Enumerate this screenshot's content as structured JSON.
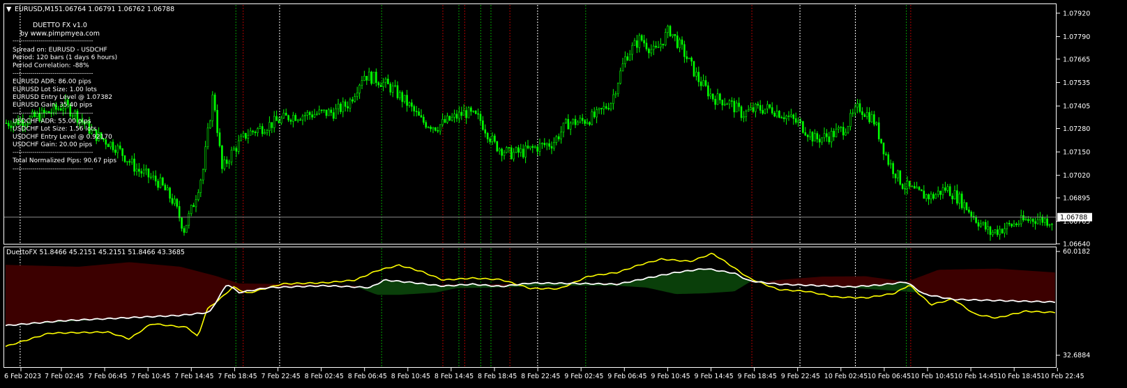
{
  "main_header": {
    "arrow": "▼",
    "symbol": "EURUSD,M15",
    "ohlc": "1.06764 1.06791 1.06762 1.06788"
  },
  "info_panel": {
    "title": "DUETTO FX v1.0",
    "byline": "by www.pimpmyea.com",
    "lines_1": [
      "Spread on: EURUSD - USDCHF",
      "Period: 120 bars (1 days 6 hours)",
      "Period Correlation: -88%"
    ],
    "lines_2": [
      "EURUSD ADR: 86.00   pips",
      "EURUSD Lot Size: 1.00 lots",
      "EURUSD Entry Level @ 1.07382",
      "EURUSD Gain: 35.40 pips"
    ],
    "lines_3": [
      "USDCHF ADR: 55.00   pips",
      "USDCHF Lot Size: 1.56 lots",
      "USDCHF Entry Level @ 0.92170",
      "USDCHF Gain: 20.00 pips"
    ],
    "lines_4": [
      "Total Normalized Pips: 90.67 pips"
    ],
    "separator": "----------------------------------------"
  },
  "indicator_header": {
    "text": "DuettoFX 51.8466 45.2151 45.2151 51.8466 43.3685"
  },
  "colors": {
    "background": "#000000",
    "candle": "#00ff00",
    "grid_border": "#ffffff",
    "axis_text": "#ffffff",
    "band_red": "#3c0000",
    "band_green": "#0a3f0a",
    "white_line": "#ffffff",
    "yellow_line": "#ffff00",
    "vline_white": "#ffffff",
    "vline_green": "#00a000",
    "vline_red": "#b00000"
  },
  "chart_data": [
    {
      "type": "candlestick",
      "title": "EURUSD,M15",
      "y_ticks": [
        "1.07920",
        "1.07790",
        "1.07665",
        "1.07535",
        "1.07405",
        "1.07280",
        "1.07150",
        "1.07020",
        "1.06895",
        "1.06765",
        "1.06640"
      ],
      "ylim": [
        1.0664,
        1.0797
      ],
      "current_price_label": "1.06788",
      "current_price": 1.06788,
      "x_labels": [
        "6 Feb 2023",
        "7 Feb 02:45",
        "7 Feb 06:45",
        "7 Feb 10:45",
        "7 Feb 14:45",
        "7 Feb 18:45",
        "7 Feb 22:45",
        "8 Feb 02:45",
        "8 Feb 06:45",
        "8 Feb 10:45",
        "8 Feb 14:45",
        "8 Feb 18:45",
        "8 Feb 22:45",
        "9 Feb 02:45",
        "9 Feb 06:45",
        "9 Feb 10:45",
        "9 Feb 14:45",
        "9 Feb 18:45",
        "9 Feb 22:45",
        "10 Feb 02:45",
        "10 Feb 06:45",
        "10 Feb 10:45",
        "10 Feb 14:45",
        "10 Feb 18:45",
        "10 Feb 22:45"
      ],
      "close_path": [
        [
          0,
          1.0731
        ],
        [
          1.5,
          1.0733
        ],
        [
          3,
          1.0737
        ],
        [
          4,
          1.0741
        ],
        [
          5,
          1.0734
        ],
        [
          6,
          1.0725
        ],
        [
          7.5,
          1.0718
        ],
        [
          9,
          1.0705
        ],
        [
          10.5,
          1.0698
        ],
        [
          11.5,
          1.0687
        ],
        [
          12.2,
          1.0672
        ],
        [
          12.8,
          1.0685
        ],
        [
          13.5,
          1.0705
        ],
        [
          14.2,
          1.0748
        ],
        [
          14.8,
          1.0705
        ],
        [
          15.5,
          1.0715
        ],
        [
          16.5,
          1.0725
        ],
        [
          18,
          1.073
        ],
        [
          19.5,
          1.0735
        ],
        [
          21,
          1.0736
        ],
        [
          22.5,
          1.0737
        ],
        [
          23.5,
          1.0742
        ],
        [
          24.5,
          1.0758
        ],
        [
          25.5,
          1.0755
        ],
        [
          26.5,
          1.075
        ],
        [
          27.5,
          1.0742
        ],
        [
          28.5,
          1.0732
        ],
        [
          29.5,
          1.0729
        ],
        [
          30.5,
          1.0733
        ],
        [
          31.5,
          1.0737
        ],
        [
          32.5,
          1.0733
        ],
        [
          33.5,
          1.0719
        ],
        [
          34.5,
          1.0714
        ],
        [
          35.5,
          1.0715
        ],
        [
          36.5,
          1.0718
        ],
        [
          37.5,
          1.072
        ],
        [
          38.5,
          1.0731
        ],
        [
          39.5,
          1.0732
        ],
        [
          40.5,
          1.0735
        ],
        [
          41.5,
          1.0743
        ],
        [
          42.5,
          1.0768
        ],
        [
          43.5,
          1.0778
        ],
        [
          44.5,
          1.077
        ],
        [
          45.5,
          1.0783
        ],
        [
          46.5,
          1.077
        ],
        [
          47.5,
          1.0755
        ],
        [
          48.5,
          1.0745
        ],
        [
          49.5,
          1.0743
        ],
        [
          50.5,
          1.0736
        ],
        [
          51.5,
          1.0739
        ],
        [
          52.5,
          1.0739
        ],
        [
          53.5,
          1.0735
        ],
        [
          54.5,
          1.073
        ],
        [
          55.5,
          1.0722
        ],
        [
          56.5,
          1.0724
        ],
        [
          57.5,
          1.0728
        ],
        [
          58.5,
          1.074
        ],
        [
          59.5,
          1.0733
        ],
        [
          60.5,
          1.071
        ],
        [
          61.5,
          1.0697
        ],
        [
          62.5,
          1.0692
        ],
        [
          63.5,
          1.069
        ],
        [
          64.5,
          1.0695
        ],
        [
          65.5,
          1.0688
        ],
        [
          66.5,
          1.0678
        ],
        [
          67.5,
          1.067
        ],
        [
          68.5,
          1.0673
        ],
        [
          69.5,
          1.0676
        ],
        [
          70.5,
          1.0678
        ],
        [
          71.5,
          1.0677
        ]
      ],
      "vlines": [
        {
          "x": 1,
          "style": "white"
        },
        {
          "x": 15.8,
          "style": "green"
        },
        {
          "x": 16.3,
          "style": "red"
        },
        {
          "x": 18.8,
          "style": "white"
        },
        {
          "x": 25.8,
          "style": "green"
        },
        {
          "x": 30,
          "style": "red"
        },
        {
          "x": 31.1,
          "style": "green"
        },
        {
          "x": 31.5,
          "style": "red"
        },
        {
          "x": 32.6,
          "style": "green"
        },
        {
          "x": 33.3,
          "style": "green"
        },
        {
          "x": 34.6,
          "style": "red"
        },
        {
          "x": 36.5,
          "style": "white"
        },
        {
          "x": 39.8,
          "style": "green"
        },
        {
          "x": 51.2,
          "style": "red"
        },
        {
          "x": 54.5,
          "style": "white"
        },
        {
          "x": 58.3,
          "style": "white"
        },
        {
          "x": 61.8,
          "style": "green"
        },
        {
          "x": 62.1,
          "style": "red"
        }
      ]
    },
    {
      "type": "area",
      "title": "DuettoFX",
      "y_ticks": [
        "60.0182",
        "32.6884"
      ],
      "ylim": [
        32.6884,
        60.0182
      ],
      "series": [
        {
          "name": "white",
          "points": [
            [
              0,
              40.5
            ],
            [
              4,
              41.8
            ],
            [
              8,
              42.5
            ],
            [
              12,
              43.2
            ],
            [
              14,
              44
            ],
            [
              15.2,
              51.5
            ],
            [
              16,
              49.2
            ],
            [
              18,
              50.5
            ],
            [
              22,
              51
            ],
            [
              25,
              50.5
            ],
            [
              26,
              52.5
            ],
            [
              28,
              51.8
            ],
            [
              30,
              50.9
            ],
            [
              32,
              51.4
            ],
            [
              34,
              50.8
            ],
            [
              36,
              51.7
            ],
            [
              39,
              51.6
            ],
            [
              42,
              51.4
            ],
            [
              44,
              53.0
            ],
            [
              46,
              54.5
            ],
            [
              48,
              55.5
            ],
            [
              50,
              54.3
            ],
            [
              51,
              52.3
            ],
            [
              53,
              51.4
            ],
            [
              56,
              51
            ],
            [
              58,
              50.7
            ],
            [
              60,
              51.2
            ],
            [
              61.8,
              52.0
            ],
            [
              63,
              48.8
            ],
            [
              65,
              47.4
            ],
            [
              67,
              47.2
            ],
            [
              69,
              47
            ],
            [
              71,
              46.8
            ],
            [
              72,
              46.7
            ]
          ]
        },
        {
          "name": "yellow",
          "points": [
            [
              0,
              35
            ],
            [
              3,
              38.5
            ],
            [
              7,
              38.8
            ],
            [
              8.5,
              37
            ],
            [
              10,
              41
            ],
            [
              12.5,
              40
            ],
            [
              13.2,
              37.5
            ],
            [
              13.8,
              44.7
            ],
            [
              15,
              48.5
            ],
            [
              15.6,
              50.7
            ],
            [
              16.6,
              49
            ],
            [
              19,
              51.5
            ],
            [
              22,
              51.8
            ],
            [
              24,
              52.5
            ],
            [
              25.5,
              55
            ],
            [
              27,
              56.4
            ],
            [
              28.5,
              54.8
            ],
            [
              30,
              52.5
            ],
            [
              32,
              53
            ],
            [
              34,
              52.6
            ],
            [
              36,
              50.3
            ],
            [
              38,
              50.2
            ],
            [
              40,
              53.5
            ],
            [
              42,
              54.5
            ],
            [
              43.5,
              56.5
            ],
            [
              45,
              58
            ],
            [
              47,
              57.4
            ],
            [
              48.5,
              59.5
            ],
            [
              49.5,
              57
            ],
            [
              51,
              53
            ],
            [
              53,
              50
            ],
            [
              55,
              49.5
            ],
            [
              57,
              48
            ],
            [
              59,
              47.8
            ],
            [
              61,
              49
            ],
            [
              62,
              51.2
            ],
            [
              63.5,
              46
            ],
            [
              65,
              47.5
            ],
            [
              66.5,
              43.5
            ],
            [
              68,
              42.5
            ],
            [
              70,
              44.3
            ],
            [
              71.5,
              44
            ]
          ]
        },
        {
          "name": "red_band_upper",
          "points": [
            [
              0,
              56.5
            ],
            [
              5,
              56
            ],
            [
              8.5,
              57.2
            ],
            [
              12,
              56
            ],
            [
              14.5,
              53.5
            ],
            [
              16,
              51.6
            ],
            [
              20,
              51.4
            ],
            [
              24,
              51
            ],
            [
              26,
              50
            ],
            [
              28,
              50
            ],
            [
              30,
              51.3
            ],
            [
              34,
              51.4
            ],
            [
              38,
              51.6
            ],
            [
              41,
              51.6
            ],
            [
              46,
              51.5
            ],
            [
              48,
              51.4
            ],
            [
              50,
              51.4
            ],
            [
              51,
              51.3
            ],
            [
              53,
              52.5
            ],
            [
              56,
              53.4
            ],
            [
              59,
              53.5
            ],
            [
              61.8,
              52.0
            ],
            [
              64,
              55.2
            ],
            [
              68,
              55.5
            ],
            [
              70,
              55
            ],
            [
              72,
              54.5
            ]
          ]
        },
        {
          "name": "green_band_lower",
          "points": [
            [
              0,
              40.5
            ],
            [
              14,
              44
            ],
            [
              15.2,
              51.5
            ],
            [
              24,
              50.8
            ],
            [
              25.5,
              48.6
            ],
            [
              27,
              48.6
            ],
            [
              29.5,
              49.2
            ],
            [
              31,
              50.4
            ],
            [
              33.5,
              50.5
            ],
            [
              38,
              51.0
            ],
            [
              42,
              51.0
            ],
            [
              44,
              50.5
            ],
            [
              46,
              48.8
            ],
            [
              48,
              49.0
            ],
            [
              50,
              49.5
            ],
            [
              51.2,
              52.3
            ],
            [
              72,
              46.7
            ]
          ]
        }
      ]
    }
  ]
}
